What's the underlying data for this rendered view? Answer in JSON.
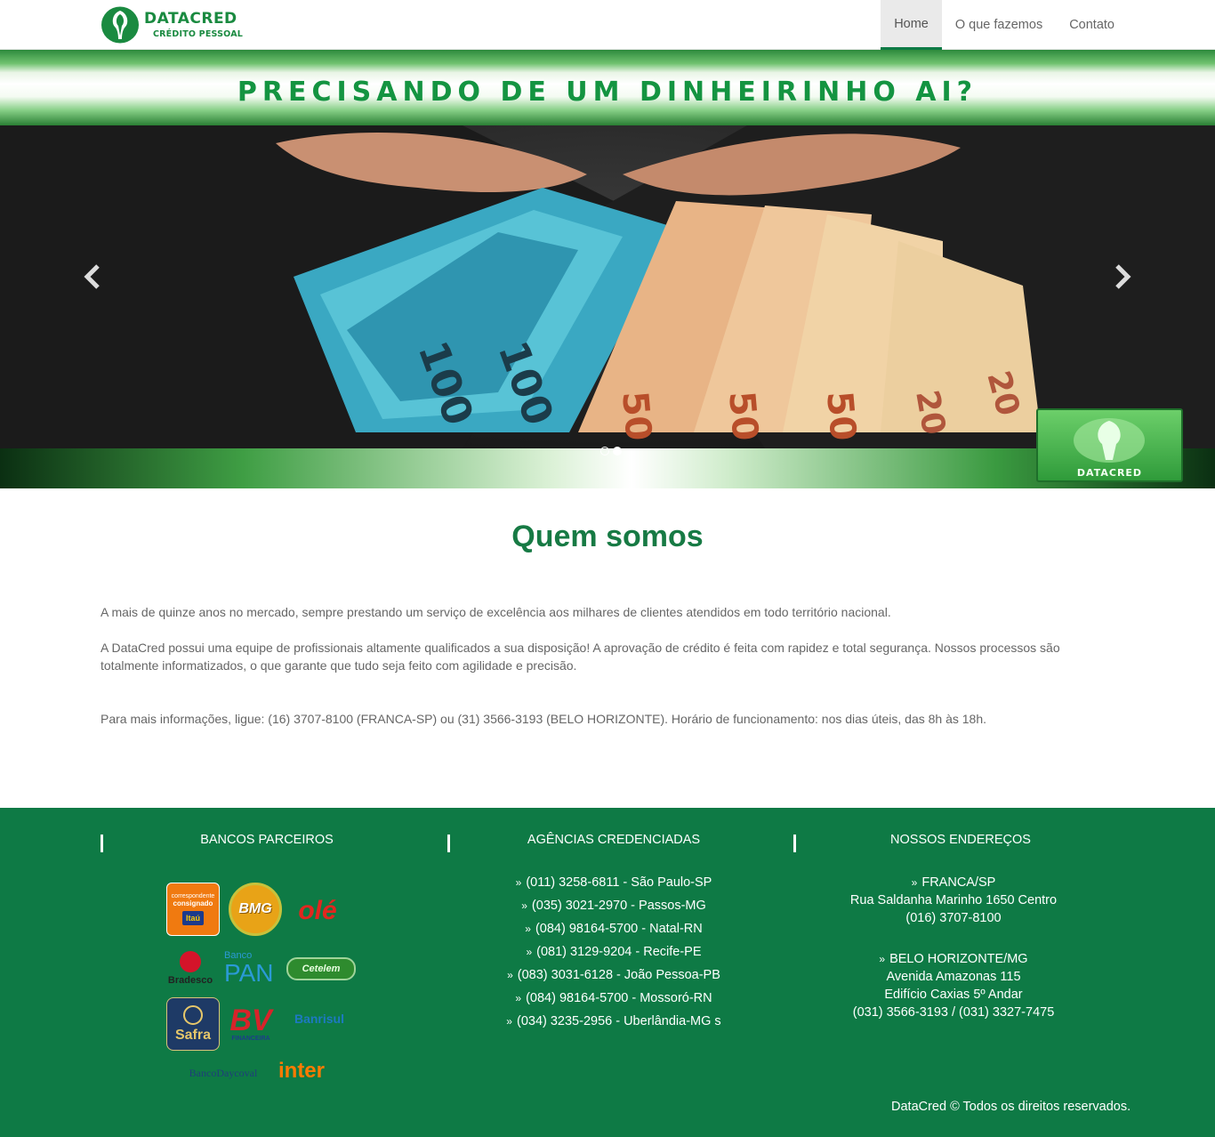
{
  "brand": {
    "name": "DATACRED",
    "tagline": "CRÉDITO PESSOAL",
    "primary_color": "#0e7a45"
  },
  "nav": {
    "items": [
      {
        "label": "Home",
        "active": true
      },
      {
        "label": "O que fazemos",
        "active": false
      },
      {
        "label": "Contato",
        "active": false
      }
    ]
  },
  "carousel": {
    "headline": "PRECISANDO DE UM DINHEIRINHO AI?",
    "badge_text": "DATACRED",
    "slides": 2,
    "active_slide": 2,
    "prev_icon": "chevron-left-icon",
    "next_icon": "chevron-right-icon"
  },
  "about": {
    "title": "Quem somos",
    "paragraphs": [
      "A mais de quinze anos no mercado, sempre prestando um serviço de excelência aos milhares de clientes atendidos em todo território nacional.",
      "A DataCred possui uma equipe de profissionais altamente qualificados a sua disposição! A aprovação de crédito é feita com rapidez e total segurança. Nossos processos são totalmente informatizados, o que garante que tudo seja feito com agilidade e precisão.",
      "Para mais informações, ligue: (16) 3707-8100 (FRANCA-SP) ou (31) 3566-3193 (BELO HORIZONTE). Horário de funcionamento: nos dias úteis, das 8h às 18h."
    ]
  },
  "footer": {
    "banks_title": "BANCOS PARCEIROS",
    "agencies_title": "AGÊNCIAS CREDENCIADAS",
    "addresses_title": "NOSSOS ENDEREÇOS",
    "banks": {
      "itau_line1": "correspondente",
      "itau_line2": "consignado",
      "itau_name": "Itaú",
      "bmg": "BMG",
      "ole": "olé",
      "bradesco": "Bradesco",
      "pan_small": "Banco",
      "pan": "PAN",
      "cetelem": "Cetelem",
      "safra": "Safra",
      "bv": "BV",
      "bv_sub": "FINANCEIRA",
      "banrisul": "Banrisul",
      "daycoval": "BancoDaycoval",
      "inter": "inter"
    },
    "agencies": [
      "(011) 3258-6811 - São Paulo-SP",
      "(035) 3021-2970 - Passos-MG",
      "(084) 98164-5700 - Natal-RN",
      "(081) 3129-9204 - Recife-PE",
      "(083) 3031-6128 - João Pessoa-PB",
      "(084) 98164-5700 - Mossoró-RN",
      "(034) 3235-2956 - Uberlândia-MG s"
    ],
    "addresses": [
      {
        "city": "FRANCA/SP",
        "lines": [
          "Rua Saldanha Marinho 1650 Centro",
          "(016) 3707-8100"
        ]
      },
      {
        "city": "BELO HORIZONTE/MG",
        "lines": [
          "Avenida Amazonas 115",
          "Edifício Caxias 5º Andar",
          "(031) 3566-3193 / (031) 3327-7475"
        ]
      }
    ],
    "copyright": "DataCred © Todos os direitos reservados."
  }
}
